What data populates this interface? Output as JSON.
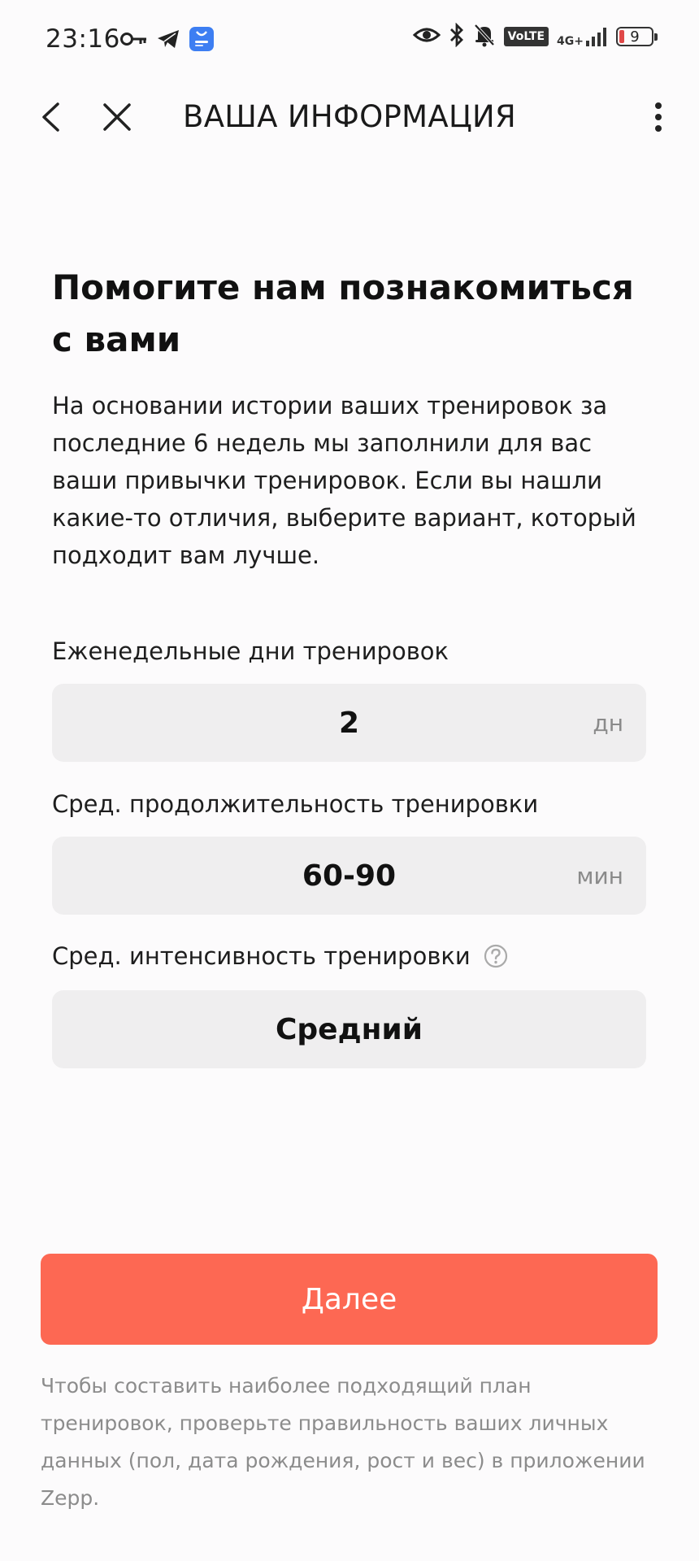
{
  "status_bar": {
    "time": "23:16",
    "network_label": "VoLTE",
    "network_type": "4G+",
    "battery_level": "9",
    "left_icons": [
      "key-icon",
      "telegram-icon",
      "app-notification-icon"
    ],
    "right_icons": [
      "eye-icon",
      "bluetooth-icon",
      "bell-muted-icon",
      "volte-icon",
      "signal-icon",
      "battery-icon"
    ]
  },
  "topnav": {
    "title": "ВАША ИНФОРМАЦИЯ",
    "back_icon": "chevron-left-icon",
    "close_icon": "close-icon",
    "more_icon": "more-vertical-icon"
  },
  "main": {
    "heading": "Помогите нам познакомиться с вами",
    "description": "На основании истории ваших тренировок за последние 6 недель мы заполнили для вас ваши привычки тренировок. Если вы нашли какие-то отличия, выберите вариант, который подходит вам лучше.",
    "fields": [
      {
        "label": "Еженедельные дни тренировок",
        "value": "2",
        "unit": "дн"
      },
      {
        "label": "Сред. продолжительность тренировки",
        "value": "60-90",
        "unit": "мин"
      },
      {
        "label": "Сред. интенсивность тренировки",
        "value": "Средний",
        "unit": "",
        "help_icon": "question-circle-icon"
      }
    ]
  },
  "actions": {
    "next_label": "Далее"
  },
  "footer": {
    "note": "Чтобы составить наиболее подходящий план тренировок, проверьте правильность ваших личных данных (пол, дата рождения, рост и вес) в приложении Zepp."
  },
  "colors": {
    "accent": "#fd6853",
    "field_background": "#efeeef",
    "page_background": "#fcfbfc",
    "muted_text": "#8c8c8c"
  }
}
